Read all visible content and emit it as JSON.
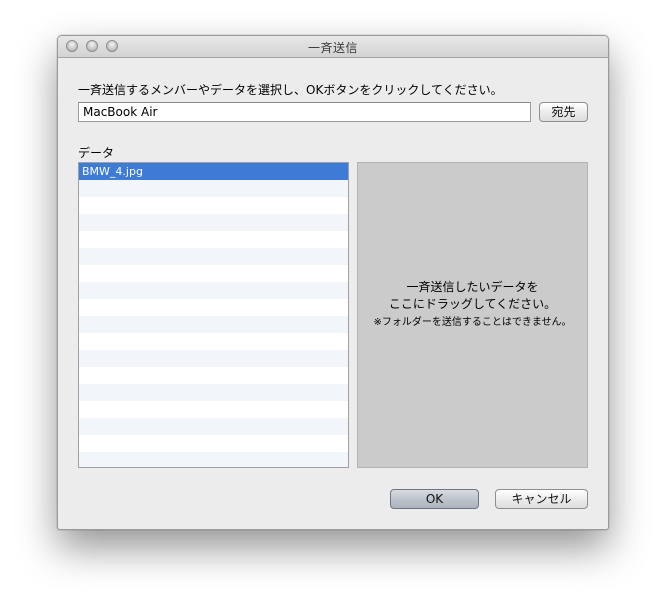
{
  "window": {
    "title": "一斉送信"
  },
  "instruction": "一斉送信するメンバーやデータを選択し、OKボタンをクリックしてください。",
  "destination": {
    "value": "MacBook Air",
    "button_label": "宛先"
  },
  "data_section": {
    "label": "データ",
    "files": [
      "BMW_4.jpg"
    ],
    "selected_index": 0
  },
  "drop_zone": {
    "line1": "一斉送信したいデータを",
    "line2": "ここにドラッグしてください。",
    "note": "※フォルダーを送信することはできません。"
  },
  "footer": {
    "ok_label": "OK",
    "cancel_label": "キャンセル"
  },
  "colors": {
    "selection": "#3d7bd6",
    "drop_zone_bg": "#cbcbcb"
  }
}
